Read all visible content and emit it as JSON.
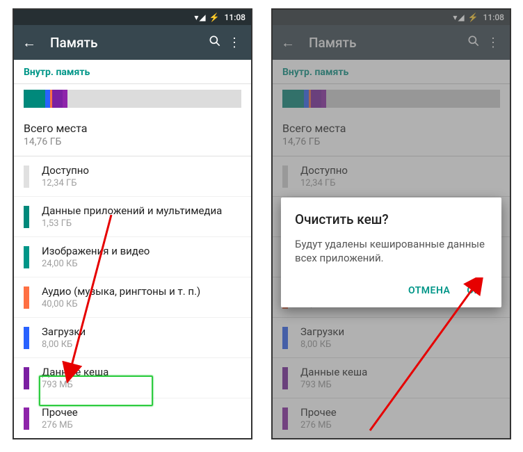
{
  "status": {
    "time": "11:08",
    "icons": "▾◢ ⚡"
  },
  "toolbar": {
    "title": "Память",
    "back_glyph": "←",
    "search_glyph": "🔍",
    "more_glyph": "⋮"
  },
  "tab": {
    "label": "Внутр. память"
  },
  "total": {
    "label": "Всего места",
    "value": "14,76 ГБ"
  },
  "items": [
    {
      "label": "Доступно",
      "value": "12,34 ГБ",
      "color": "#e0e0e0"
    },
    {
      "label": "Данные приложений и мультимедиа",
      "value": "1,53 ГБ",
      "color": "#00897b"
    },
    {
      "label": "Изображения и видео",
      "value": "24,00 КБ",
      "color": "#009688"
    },
    {
      "label": "Аудио (музыка, рингтоны и т. п.)",
      "value": "40,00 КБ",
      "color": "#ff7043"
    },
    {
      "label": "Загрузки",
      "value": "8,00 КБ",
      "color": "#2962ff"
    },
    {
      "label": "Данные кеша",
      "value": "793 МБ",
      "color": "#7b1fa2"
    },
    {
      "label": "Прочее",
      "value": "276 МБ",
      "color": "#8e24aa"
    }
  ],
  "usage_segments": [
    {
      "color": "#00897b",
      "pct": 10
    },
    {
      "color": "#2962ff",
      "pct": 2
    },
    {
      "color": "#ff7043",
      "pct": 1
    },
    {
      "color": "#7b1fa2",
      "pct": 5
    },
    {
      "color": "#8e24aa",
      "pct": 2
    },
    {
      "color": "#dcdcdc",
      "pct": 80
    }
  ],
  "dialog": {
    "title": "Очистить кеш?",
    "message": "Будут удалены кешированные данные всех приложений.",
    "cancel": "ОТМЕНА",
    "ok": "ОК"
  }
}
